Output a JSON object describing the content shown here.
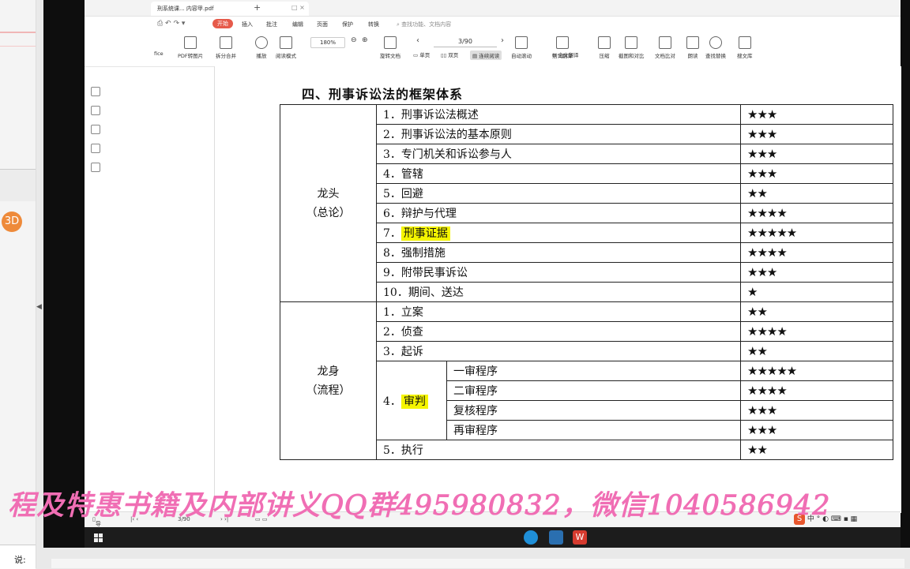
{
  "window": {
    "tab_title": "刑系统课... 内容甲.pdf",
    "new_tab": "+"
  },
  "menu": {
    "items": [
      "开始",
      "插入",
      "批注",
      "编辑",
      "页面",
      "保护",
      "转换"
    ],
    "search_placeholder": "查找功能、文档内容"
  },
  "toolbar": {
    "zoom": "180%",
    "page": "3/90",
    "buttons_top": [
      "PDF转图片",
      "拆分合并",
      "播放",
      "阅读模式",
      "旋转文档",
      "自动滚动",
      "划词翻译",
      "压缩",
      "截图和对比",
      "文档比对",
      "朗读",
      "查找替换",
      "搜文库"
    ],
    "buttons_row2": [
      "fice",
      "单页",
      "双页",
      "连续阅读",
      "全文翻译"
    ]
  },
  "document": {
    "heading": "四、刑事诉讼法的框架体系",
    "sections": [
      {
        "category": [
          "龙头",
          "（总论）"
        ],
        "rows": [
          {
            "label": "1．刑事诉讼法概述",
            "stars": "★★★"
          },
          {
            "label": "2．刑事诉讼法的基本原则",
            "stars": "★★★"
          },
          {
            "label": "3．专门机关和诉讼参与人",
            "stars": "★★★"
          },
          {
            "label": "4．管辖",
            "stars": "★★★"
          },
          {
            "label": "5．回避",
            "stars": "★★"
          },
          {
            "label": "6．辩护与代理",
            "stars": "★★★★"
          },
          {
            "label_num": "7．",
            "label_hl": "刑事证据",
            "stars": "★★★★★"
          },
          {
            "label": "8．强制措施",
            "stars": "★★★★"
          },
          {
            "label": "9．附带民事诉讼",
            "stars": "★★★"
          },
          {
            "label": "10．期间、送达",
            "stars": "★"
          }
        ]
      },
      {
        "category": [
          "龙身",
          "（流程）"
        ],
        "rows": [
          {
            "label": "1．立案",
            "stars": "★★"
          },
          {
            "label": "2．侦查",
            "stars": "★★★★"
          },
          {
            "label": "3．起诉",
            "stars": "★★"
          }
        ],
        "trial": {
          "label_num": "4．",
          "label_hl": "审判",
          "subs": [
            {
              "label": "一审程序",
              "stars": "★★★★★"
            },
            {
              "label": "二审程序",
              "stars": "★★★★"
            },
            {
              "label": "复核程序",
              "stars": "★★★"
            },
            {
              "label": "再审程序",
              "stars": "★★★"
            }
          ]
        },
        "last": {
          "label": "5．执行",
          "stars": "★★"
        }
      }
    ]
  },
  "status_bar": {
    "nav_label": "导航",
    "page": "3/90"
  },
  "watermark": "程及特惠书籍及内部讲义QQ群495980832，微信1040586942",
  "ime": {
    "badge": "S",
    "mode": "中"
  },
  "left_panel": {
    "badge": "3D",
    "bottom_text": "说:"
  },
  "colors": {
    "highlight": "#f5f500",
    "accent": "#e65a4a",
    "watermark": "#f06eb4"
  }
}
